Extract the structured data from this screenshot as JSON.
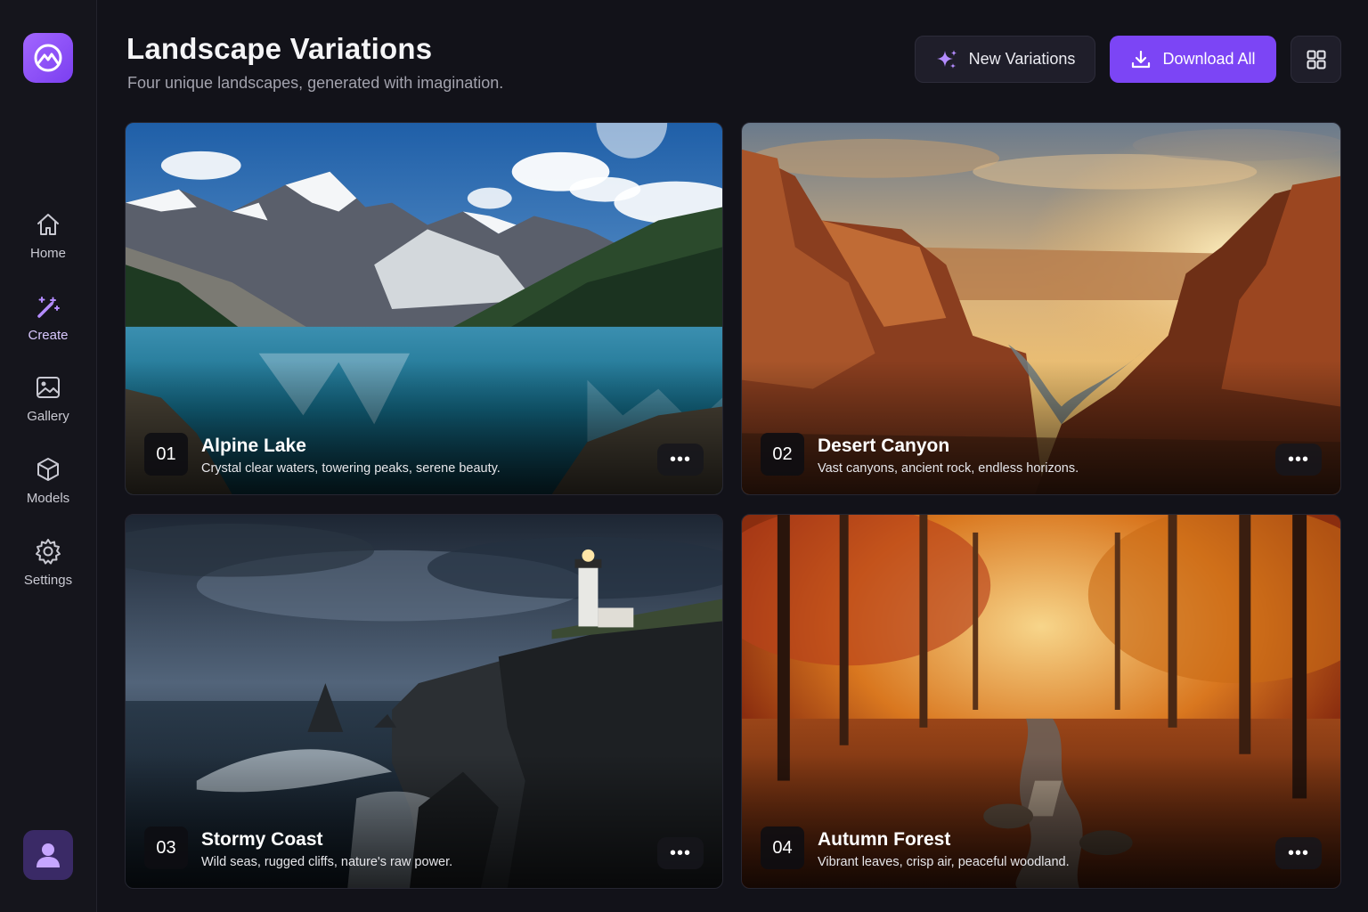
{
  "sidebar": {
    "logo_icon": "mountain-logo-icon",
    "items": [
      {
        "label": "Home",
        "icon": "home-icon"
      },
      {
        "label": "Create",
        "icon": "magic-wand-icon",
        "active": true
      },
      {
        "label": "Gallery",
        "icon": "image-icon"
      },
      {
        "label": "Models",
        "icon": "cube-icon"
      },
      {
        "label": "Settings",
        "icon": "gear-icon"
      }
    ],
    "avatar_icon": "user-icon"
  },
  "header": {
    "title": "Landscape Variations",
    "subtitle": "Four unique landscapes, generated with imagination.",
    "new_variations_label": "New Variations",
    "download_all_label": "Download All"
  },
  "cards": [
    {
      "number": "01",
      "title": "Alpine Lake",
      "description": "Crystal clear waters, towering peaks, serene beauty.",
      "more": "•••"
    },
    {
      "number": "02",
      "title": "Desert Canyon",
      "description": "Vast canyons, ancient rock, endless horizons.",
      "more": "•••"
    },
    {
      "number": "03",
      "title": "Stormy Coast",
      "description": "Wild seas, rugged cliffs, nature's raw power.",
      "more": "•••"
    },
    {
      "number": "04",
      "title": "Autumn Forest",
      "description": "Vibrant leaves, crisp air, peaceful woodland.",
      "more": "•••"
    }
  ],
  "colors": {
    "background": "#121219",
    "sidebar": "#15151c",
    "accent": "#7c45f5",
    "active_nav": "#d9c8ff"
  }
}
